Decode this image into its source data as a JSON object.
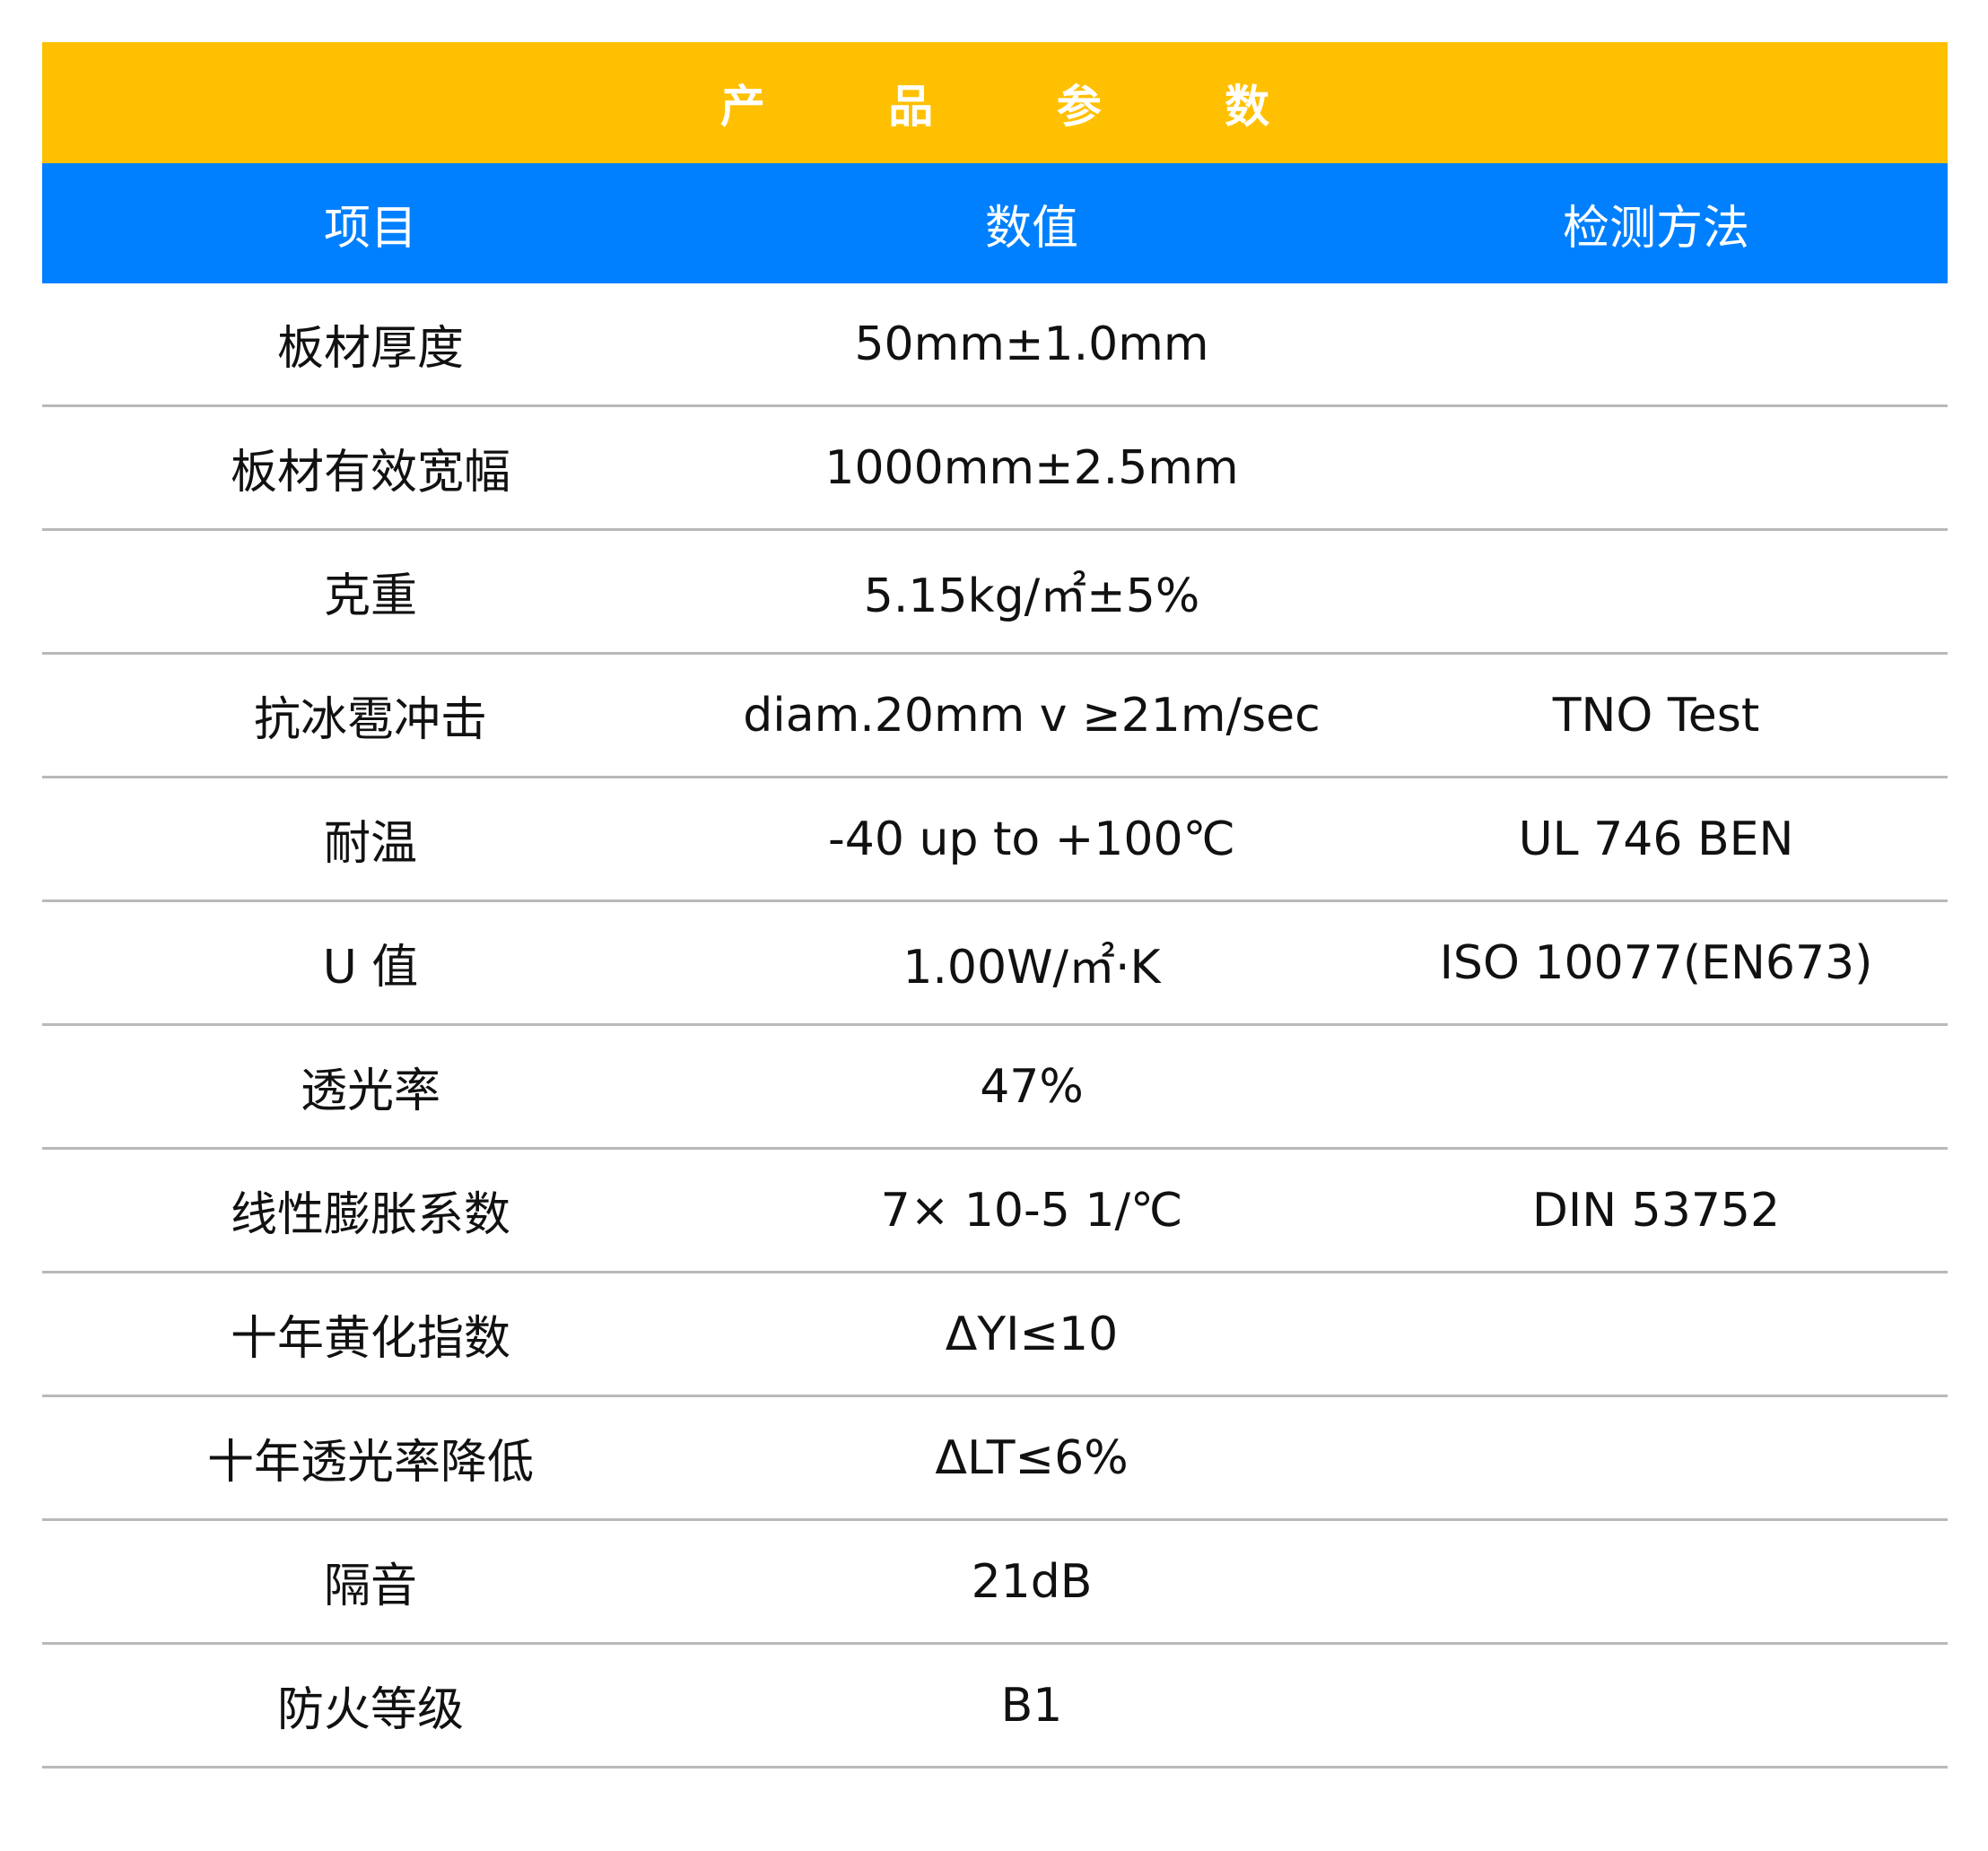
{
  "title": "产 品 参 数",
  "header": {
    "item": "项目",
    "value": "数值",
    "method": "检测方法"
  },
  "rows": [
    {
      "item": "板材厚度",
      "value": "50mm±1.0mm",
      "method": ""
    },
    {
      "item": "板材有效宽幅",
      "value": "1000mm±2.5mm",
      "method": ""
    },
    {
      "item": "克重",
      "value": "5.15kg/㎡±5%",
      "method": ""
    },
    {
      "item": "抗冰雹冲击",
      "value": "diam.20mm v  ≥21m/sec",
      "method": "TNO Test"
    },
    {
      "item": "耐温",
      "value": "-40 up to  +100℃",
      "method": "UL 746 BEN"
    },
    {
      "item": "U 值",
      "value": "1.00W/㎡·K",
      "method": "ISO 10077(EN673)"
    },
    {
      "item": "透光率",
      "value": "47%",
      "method": ""
    },
    {
      "item": "线性膨胀系数",
      "value": "7×  10-5 1/℃",
      "method": "DIN 53752"
    },
    {
      "item": "十年黄化指数",
      "value": "ΔYI≤10",
      "method": ""
    },
    {
      "item": "十年透光率降低",
      "value": "ΔLT≤6%",
      "method": ""
    },
    {
      "item": "隔音",
      "value": "21dB",
      "method": ""
    },
    {
      "item": "防火等级",
      "value": "B1",
      "method": ""
    }
  ],
  "colors": {
    "title_bg": "#FFC001",
    "header_bg": "#0080FF",
    "divider": "#b9b9b9"
  }
}
